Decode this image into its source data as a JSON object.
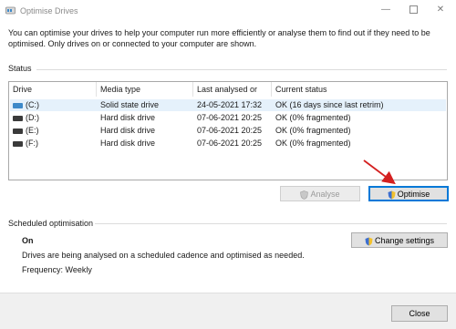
{
  "window": {
    "title": "Optimise Drives",
    "icon": "defrag-app-icon",
    "controls": {
      "minimize": "—",
      "close": "✕"
    }
  },
  "intro_text": "You can optimise your drives to help your computer run more efficiently or analyse them to find out if they need to be optimised. Only drives on or connected to your computer are shown.",
  "status": {
    "label": "Status",
    "columns": [
      "Drive",
      "Media type",
      "Last analysed or o...",
      "Current status"
    ],
    "rows": [
      {
        "drive": "(C:)",
        "media": "Solid state drive",
        "last": "24-05-2021 17:32",
        "status": "OK (16 days since last retrim)",
        "selected": true,
        "icon": "ssd-drive-icon"
      },
      {
        "drive": "(D:)",
        "media": "Hard disk drive",
        "last": "07-06-2021 20:25",
        "status": "OK (0% fragmented)",
        "selected": false,
        "icon": "hdd-drive-icon"
      },
      {
        "drive": "(E:)",
        "media": "Hard disk drive",
        "last": "07-06-2021 20:25",
        "status": "OK (0% fragmented)",
        "selected": false,
        "icon": "hdd-drive-icon"
      },
      {
        "drive": "(F:)",
        "media": "Hard disk drive",
        "last": "07-06-2021 20:25",
        "status": "OK (0% fragmented)",
        "selected": false,
        "icon": "hdd-drive-icon"
      }
    ],
    "analyse_label": "Analyse",
    "optimise_label": "Optimise"
  },
  "scheduled": {
    "label": "Scheduled optimisation",
    "state": "On",
    "description": "Drives are being analysed on a scheduled cadence and optimised as needed.",
    "frequency": "Frequency: Weekly",
    "change_settings_label": "Change settings"
  },
  "footer": {
    "close_label": "Close"
  },
  "colors": {
    "accent": "#0078d7",
    "annotation_arrow": "#d42020",
    "selected_row": "#e5f1fb"
  }
}
